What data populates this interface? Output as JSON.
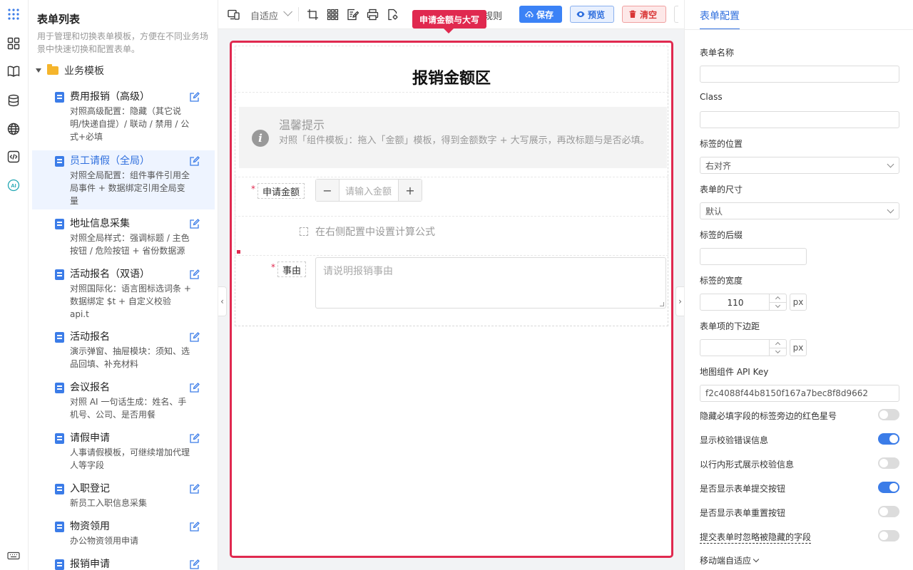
{
  "list_panel": {
    "title": "表单列表",
    "description": "用于管理和切换表单模板，方便在不同业务场景中快速切换和配置表单。",
    "folder": "业务模板",
    "items": [
      {
        "name": "费用报销（高级）",
        "desc": "对照高级配置：隐藏（其它说明/快递自提）/ 联动 / 禁用 / 公式+必填"
      },
      {
        "name": "员工请假（全局）",
        "desc": "对照全局配置：组件事件引用全局事件 + 数据绑定引用全局变量"
      },
      {
        "name": "地址信息采集",
        "desc": "对照全局样式：强调标题 / 主色按钮 / 危险按钮 + 省份数据源"
      },
      {
        "name": "活动报名（双语）",
        "desc": "对照国际化：语言图标选词条 + 数据绑定 $t + 自定义校验 api.t"
      },
      {
        "name": "活动报名",
        "desc": "演示弹窗、抽屉模块：须知、选品回填、补充材料"
      },
      {
        "name": "会议报名",
        "desc": "对照 AI 一句话生成：姓名、手机号、公司、是否用餐"
      },
      {
        "name": "请假申请",
        "desc": "人事请假模板，可继续增加代理人等字段"
      },
      {
        "name": "入职登记",
        "desc": "新员工入职信息采集"
      },
      {
        "name": "物资领用",
        "desc": "办公物资领用申请"
      },
      {
        "name": "报销申请",
        "desc": ""
      }
    ]
  },
  "rail": {
    "ai_label": "AI"
  },
  "toolbar": {
    "select_value": "自适应",
    "rule_text": "规则",
    "save_label": "保存",
    "preview_label": "预览",
    "clear_label": "清空"
  },
  "tooltip": "申请金额与大写",
  "form": {
    "title": "报销金额区",
    "notice_title": "温馨提示",
    "notice_text": "对照「组件模板」：拖入「金额」模板，得到金额数字 + 大写展示，再改标题与是否必填。",
    "amount_label": "申请金额",
    "amount_placeholder": "请输入金额",
    "required_mark": "*",
    "formula_hint": "在右侧配置中设置计算公式",
    "reason_label": "事由",
    "reason_placeholder": "请说明报销事由"
  },
  "config": {
    "tab": "表单配置",
    "form_name_label": "表单名称",
    "form_name_value": "",
    "class_label": "Class",
    "class_value": "",
    "label_position_label": "标签的位置",
    "label_position_value": "右对齐",
    "form_size_label": "表单的尺寸",
    "form_size_value": "默认",
    "label_suffix_label": "标签的后缀",
    "label_suffix_value": "",
    "label_width_label": "标签的宽度",
    "label_width_value": "110",
    "unit_px": "px",
    "item_margin_label": "表单项的下边距",
    "item_margin_value": "",
    "map_key_label": "地图组件 API Key",
    "map_key_value": "f2c4088f44b8150f167a7bec8f8d9662",
    "toggles": [
      {
        "label": "隐藏必填字段的标签旁边的红色星号",
        "on": false
      },
      {
        "label": "显示校验错误信息",
        "on": true
      },
      {
        "label": "以行内形式展示校验信息",
        "on": false
      },
      {
        "label": "是否显示表单提交按钮",
        "on": true
      },
      {
        "label": "是否显示表单重置按钮",
        "on": false
      },
      {
        "label": "提交表单时忽略被隐藏的字段",
        "on": false
      }
    ],
    "mobile_label": "移动端自适应"
  },
  "colors": {
    "accent": "#2f6fde",
    "danger": "#e0294f",
    "primary_button": "#3b82f6"
  }
}
